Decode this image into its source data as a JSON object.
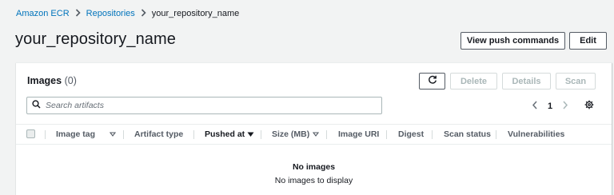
{
  "breadcrumb": {
    "items": [
      "Amazon ECR",
      "Repositories",
      "your_repository_name"
    ]
  },
  "page": {
    "title": "your_repository_name",
    "view_push_commands": "View push commands",
    "edit": "Edit"
  },
  "images_panel": {
    "title": "Images",
    "count": "(0)",
    "actions": {
      "delete": "Delete",
      "details": "Details",
      "scan": "Scan"
    },
    "search": {
      "placeholder": "Search artifacts"
    },
    "pagination": {
      "current_page": "1"
    },
    "columns": [
      "Image tag",
      "Artifact type",
      "Pushed at",
      "Size (MB)",
      "Image URI",
      "Digest",
      "Scan status",
      "Vulnerabilities"
    ],
    "empty_title": "No images",
    "empty_message": "No images to display"
  },
  "colors": {
    "link": "#0073bb",
    "page_bg": "#f2f3f3",
    "text": "#16191f",
    "muted": "#545b64",
    "disabled": "#aab7b8"
  }
}
